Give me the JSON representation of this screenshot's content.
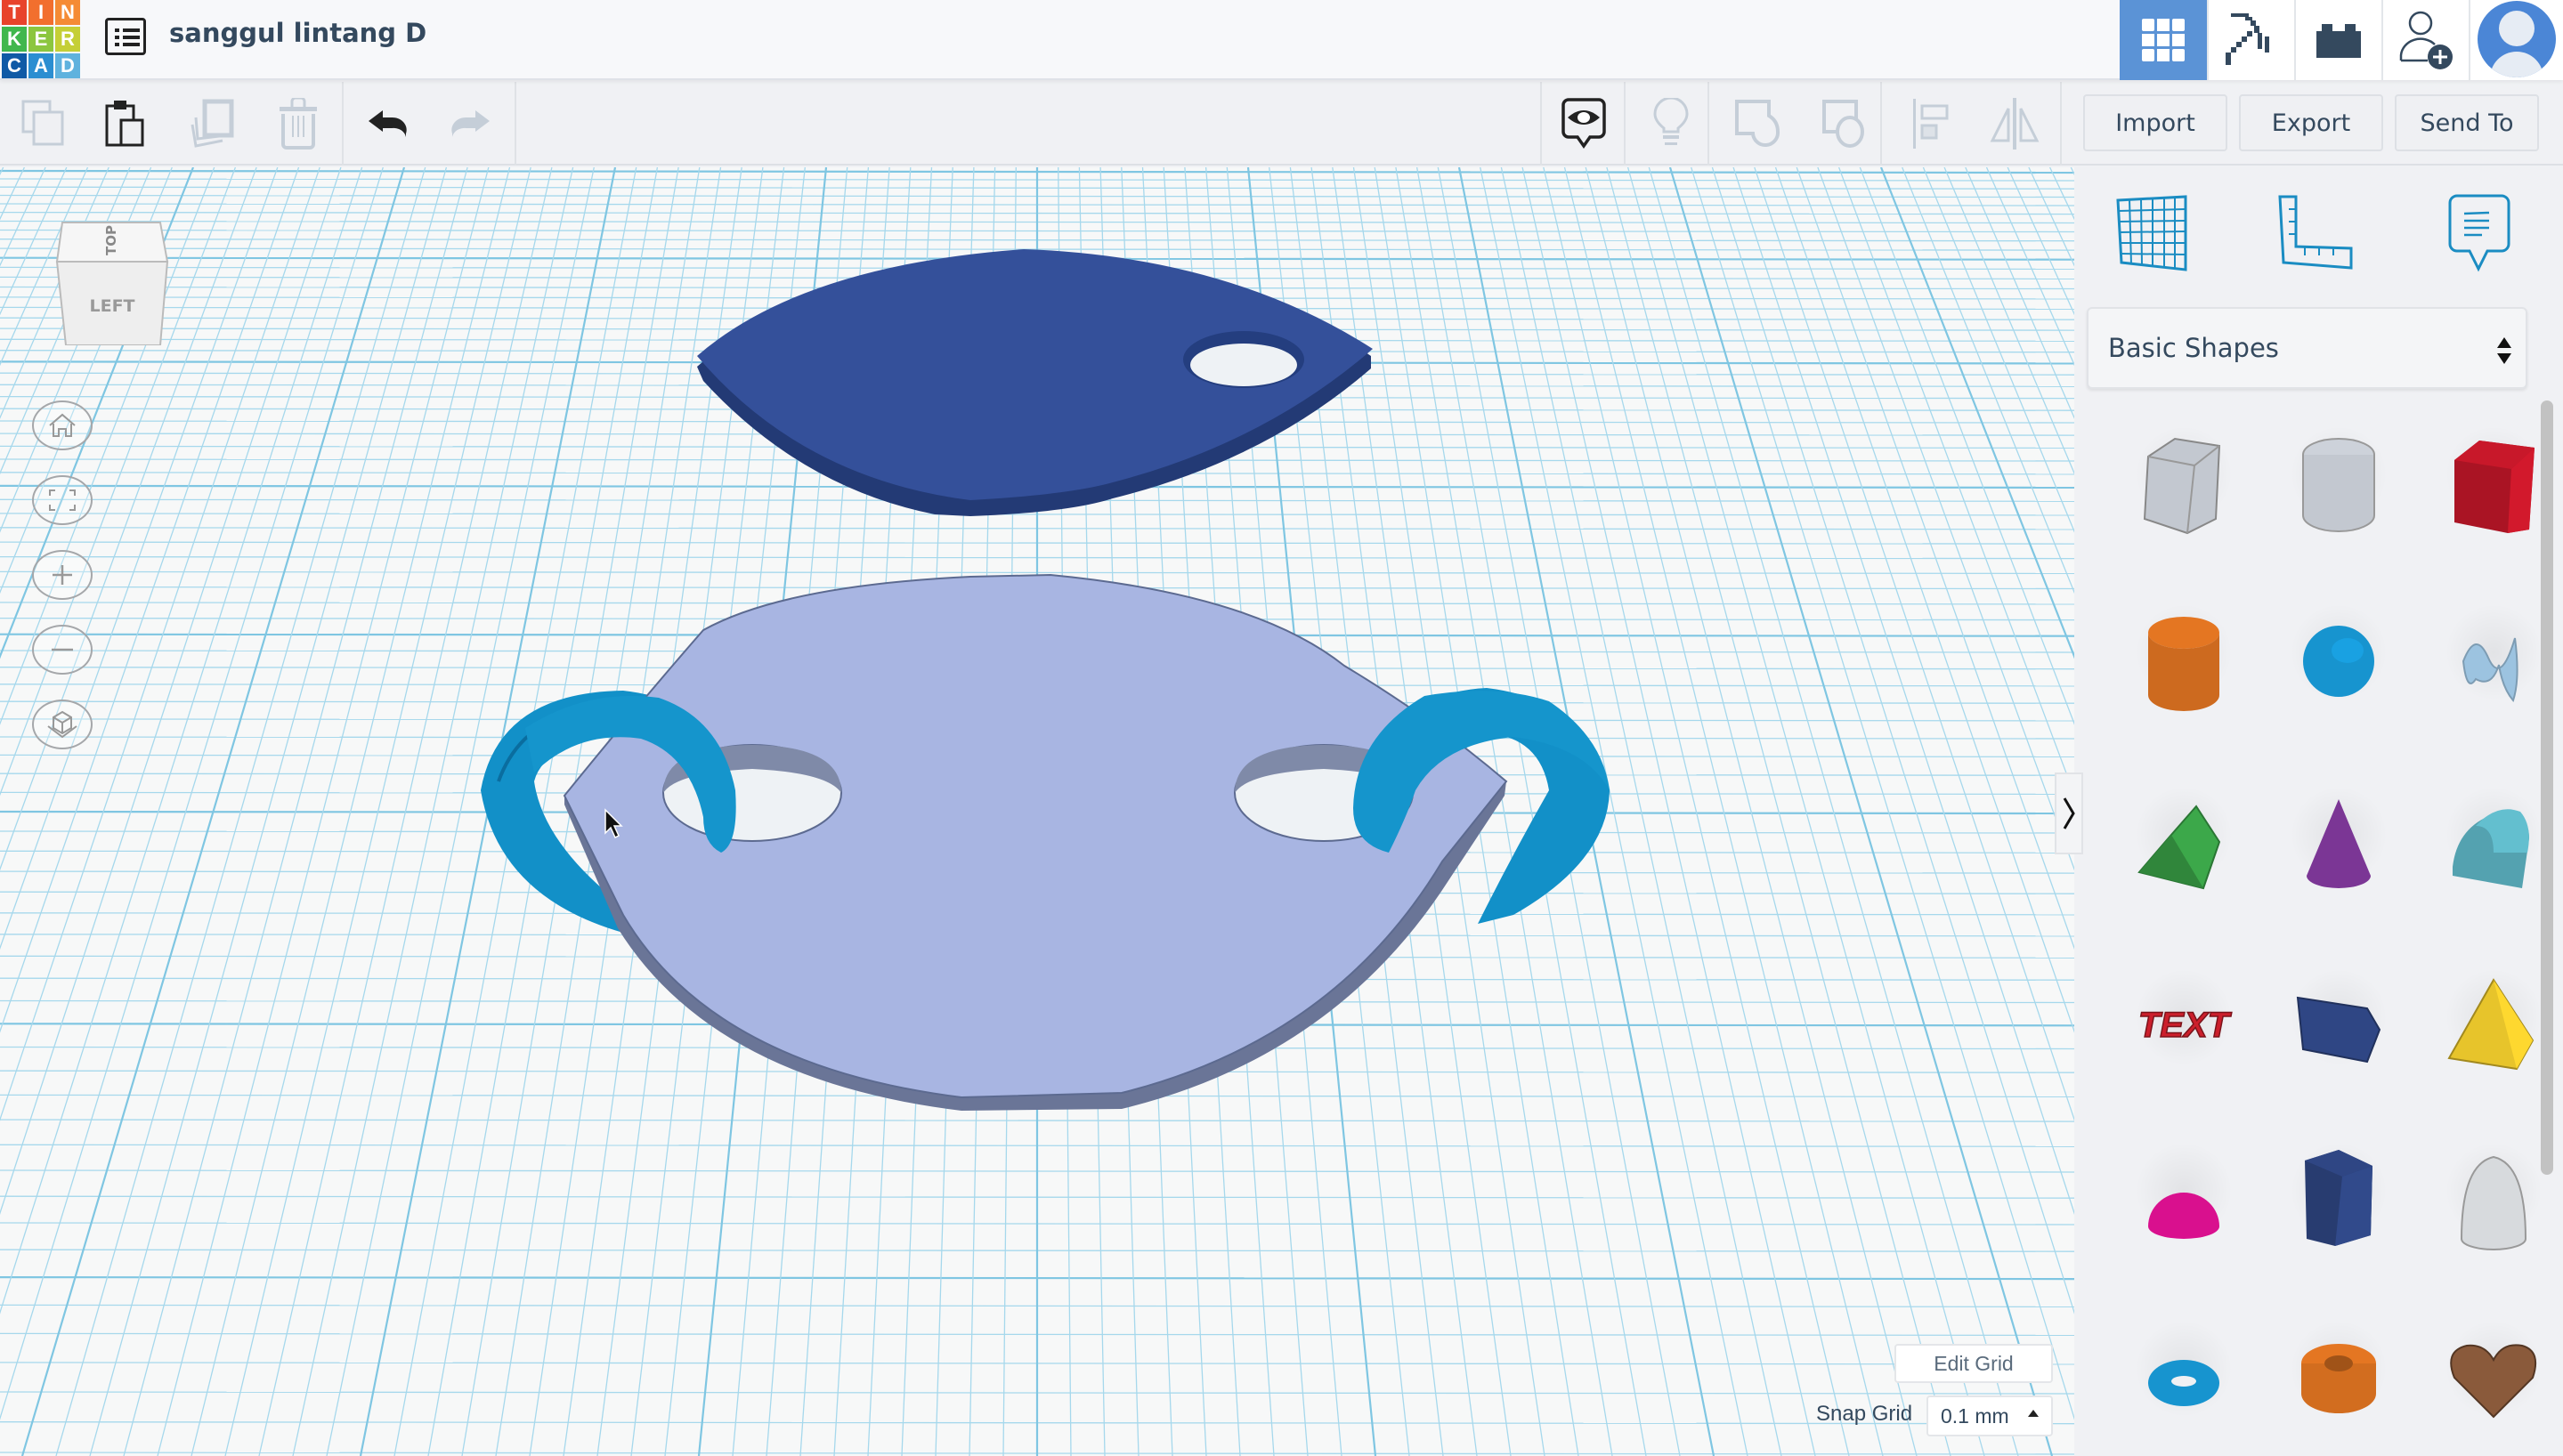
{
  "app": {
    "logo_letters": [
      "T",
      "I",
      "N",
      "K",
      "E",
      "R",
      "C",
      "A",
      "D"
    ],
    "logo_colors": [
      "#e8432b",
      "#f26f2e",
      "#f58b35",
      "#40b74d",
      "#8cc63f",
      "#c5cf36",
      "#0f5aa6",
      "#2b8ed1",
      "#5fb2de"
    ],
    "design_title": "sanggul lintang D",
    "accent_color": "#5b93d6"
  },
  "header": {
    "buttons": [
      {
        "name": "3d-design-view",
        "icon": "grid-icon",
        "active": true
      },
      {
        "name": "blocks-view",
        "icon": "pickaxe-icon",
        "active": false
      },
      {
        "name": "bricks-view",
        "icon": "brick-icon",
        "active": false
      },
      {
        "name": "invite-user",
        "icon": "add-user-icon",
        "active": false
      },
      {
        "name": "profile",
        "icon": "avatar-icon",
        "active": false
      }
    ]
  },
  "toolbar": {
    "left_tools": [
      {
        "name": "copy",
        "icon": "copy-icon",
        "enabled": false
      },
      {
        "name": "paste",
        "icon": "paste-icon",
        "enabled": true
      },
      {
        "name": "duplicate",
        "icon": "duplicate-icon",
        "enabled": false
      },
      {
        "name": "delete",
        "icon": "trash-icon",
        "enabled": false
      },
      {
        "name": "undo",
        "icon": "undo-icon",
        "enabled": true
      },
      {
        "name": "redo",
        "icon": "redo-icon",
        "enabled": false
      }
    ],
    "right_tools": [
      {
        "name": "notes-visibility",
        "icon": "eye-bubble-icon",
        "enabled": true
      },
      {
        "name": "light",
        "icon": "lightbulb-icon",
        "enabled": false
      },
      {
        "name": "group",
        "icon": "group-icon",
        "enabled": false
      },
      {
        "name": "ungroup",
        "icon": "ungroup-icon",
        "enabled": false
      },
      {
        "name": "align",
        "icon": "align-icon",
        "enabled": false
      },
      {
        "name": "mirror",
        "icon": "mirror-icon",
        "enabled": false
      }
    ],
    "import_label": "Import",
    "export_label": "Export",
    "send_to_label": "Send To"
  },
  "viewcube": {
    "top_label": "TOP",
    "front_label": "LEFT"
  },
  "view_controls": [
    {
      "name": "home-view",
      "icon": "home-icon"
    },
    {
      "name": "fit-view",
      "icon": "fit-icon"
    },
    {
      "name": "zoom-in",
      "icon": "plus-icon"
    },
    {
      "name": "zoom-out",
      "icon": "minus-icon"
    },
    {
      "name": "perspective",
      "icon": "ortho-cube-icon"
    }
  ],
  "workplane": {
    "edit_grid_label": "Edit Grid",
    "snap_grid_label": "Snap Grid",
    "snap_grid_value": "0.1 mm",
    "objects": [
      {
        "name": "dark-blue-leaf-plate",
        "color": "#34509a"
      },
      {
        "name": "light-blue-shield-plate",
        "color": "#a8b5e2"
      },
      {
        "name": "left-torus-ring",
        "color": "#1290c8"
      },
      {
        "name": "right-torus-ring",
        "color": "#1290c8"
      }
    ]
  },
  "panel": {
    "tools": [
      {
        "name": "workplane",
        "icon": "workplane-grid-icon"
      },
      {
        "name": "ruler",
        "icon": "ruler-icon"
      },
      {
        "name": "notes",
        "icon": "note-bubble-icon"
      }
    ],
    "library_label": "Basic Shapes",
    "shapes": [
      {
        "name": "Box Hole",
        "color": "#c3c8d0"
      },
      {
        "name": "Cylinder Hole",
        "color": "#c3c8d0"
      },
      {
        "name": "Box",
        "color": "#c8182a"
      },
      {
        "name": "Cylinder",
        "color": "#e47622"
      },
      {
        "name": "Sphere",
        "color": "#1794cf"
      },
      {
        "name": "Scribble",
        "color": "#9cc3e0"
      },
      {
        "name": "Roof",
        "color": "#3ca84a"
      },
      {
        "name": "Cone",
        "color": "#7b3695"
      },
      {
        "name": "Round Roof",
        "color": "#63bfcf"
      },
      {
        "name": "Text",
        "color": "#cc1f2c"
      },
      {
        "name": "Shape Generator",
        "color": "#2f4684"
      },
      {
        "name": "Pyramid",
        "color": "#e7c42b"
      },
      {
        "name": "Half Sphere",
        "color": "#d9108e"
      },
      {
        "name": "Polygon",
        "color": "#2f4684"
      },
      {
        "name": "Paraboloid",
        "color": "#d7dadd"
      },
      {
        "name": "Torus",
        "color": "#1794cf"
      },
      {
        "name": "Tube",
        "color": "#e47622"
      },
      {
        "name": "Heart",
        "color": "#8a5a3b"
      }
    ]
  }
}
